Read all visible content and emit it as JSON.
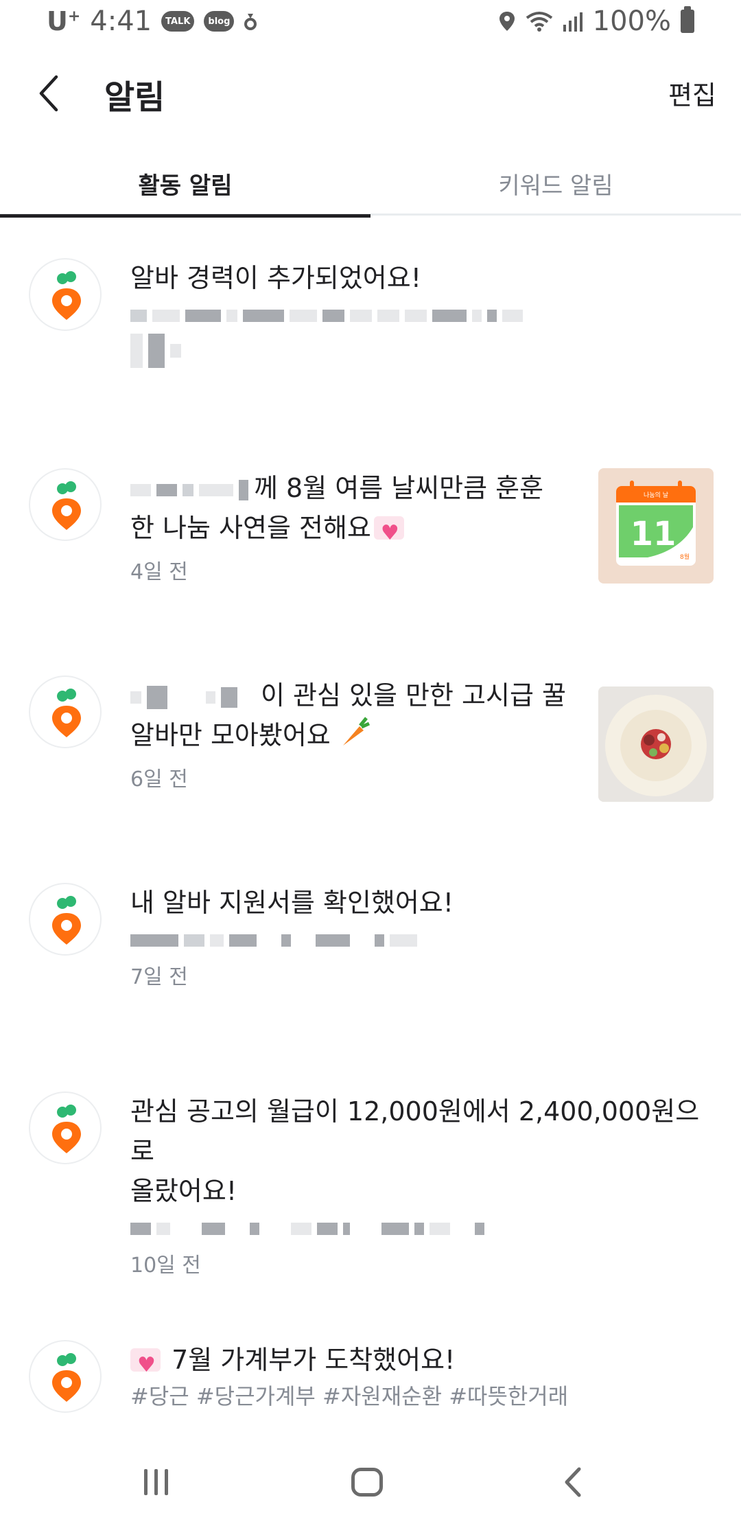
{
  "status_bar": {
    "carrier": "U",
    "carrier_sup": "+",
    "time": "4:41",
    "badges": [
      "TALK",
      "blog"
    ],
    "battery": "100%"
  },
  "header": {
    "title": "알림",
    "edit_label": "편집"
  },
  "tabs": [
    {
      "label": "활동 알림",
      "active": true
    },
    {
      "label": "키워드 알림",
      "active": false
    }
  ],
  "notifications": [
    {
      "message": "알바 경력이 추가되었어요!",
      "time": ""
    },
    {
      "message_part1": "께 8월 여름 날씨만큼 훈훈",
      "message_part2": "한 나눔 사연을 전해요",
      "time": "4일 전",
      "thumbnail": {
        "header_label": "나눔의 날",
        "day": "11",
        "corner": "8월",
        "bg": "#f1dccd",
        "calendar_green": "#6fcf6b",
        "calendar_orange": "#ff6f0f"
      }
    },
    {
      "message_part1": "이 관심 있을 만한 고시급 꿀",
      "message_part2": "알바만 모아봤어요",
      "time": "6일 전"
    },
    {
      "message": "내 알바 지원서를 확인했어요!",
      "time": "7일 전"
    },
    {
      "message_line1": "관심 공고의 월급이 12,000원에서 2,400,000원으로",
      "message_line2": "올랐어요!",
      "time": "10일 전"
    },
    {
      "message": "7월 가계부가 도착했어요!",
      "tags": "#당근 #당근가계부 #자원재순환 #따뜻한거래"
    }
  ],
  "colors": {
    "brand_orange": "#ff6f0f",
    "brand_green": "#2eb872",
    "text_primary": "#212124",
    "text_secondary": "#868b94"
  },
  "icons": {
    "avatar": "daangn-carrot-icon",
    "back": "back-arrow-icon"
  }
}
